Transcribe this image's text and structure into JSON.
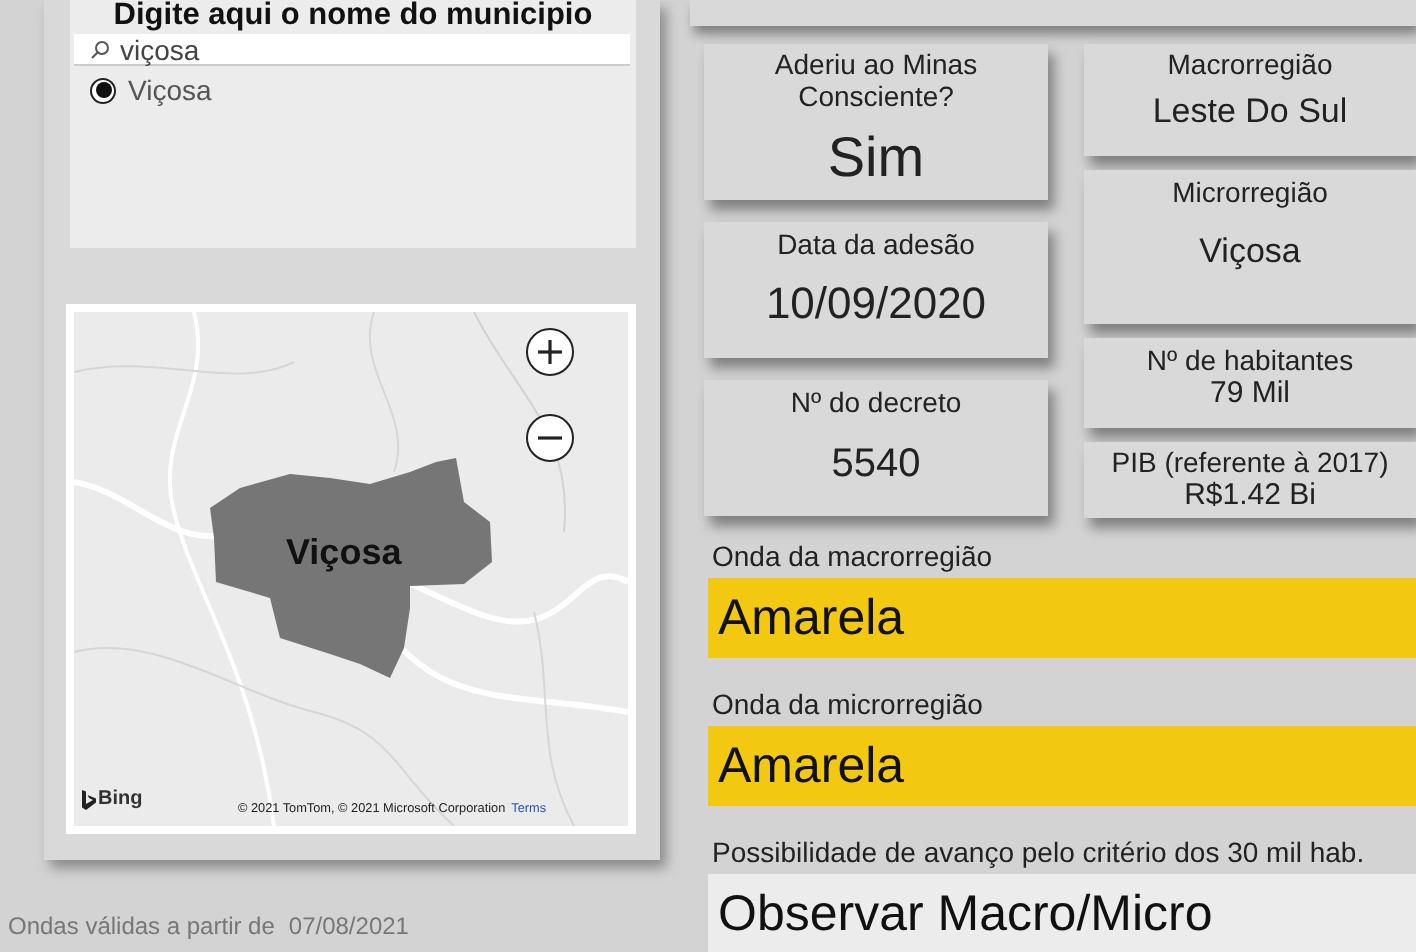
{
  "search_panel": {
    "title": "Digite aqui o nome do municipio",
    "search": {
      "value": "viçosa"
    },
    "options": [
      {
        "label": "Viçosa",
        "selected": true
      }
    ]
  },
  "map": {
    "region_label": "Viçosa",
    "provider": "Bing",
    "attribution": "© 2021 TomTom, © 2021 Microsoft Corporation",
    "terms_link": "Terms"
  },
  "validity": {
    "label": "Ondas válidas a partir de",
    "date": "07/08/2021"
  },
  "cards_left": [
    {
      "label": "Aderiu ao Minas Consciente?",
      "value": "Sim"
    },
    {
      "label": "Data da adesão",
      "value": "10/09/2020"
    },
    {
      "label": "Nº do decreto",
      "value": "5540"
    }
  ],
  "cards_right": [
    {
      "label": "Macrorregião",
      "value": "Leste Do Sul"
    },
    {
      "label": "Microrregião",
      "value": "Viçosa"
    },
    {
      "label": "Nº de habitantes",
      "value": "79 Mil"
    },
    {
      "label": "PIB (referente à 2017)",
      "value": "R$1.42 Bi"
    }
  ],
  "waves": [
    {
      "label": "Onda da macrorregião",
      "value": "Amarela",
      "color": "#f2c811"
    },
    {
      "label": "Onda da microrregião",
      "value": "Amarela",
      "color": "#f2c811"
    }
  ],
  "advance": {
    "label": "Possibilidade de avanço pelo critério dos 30 mil hab.",
    "value": "Observar Macro/Micro"
  }
}
